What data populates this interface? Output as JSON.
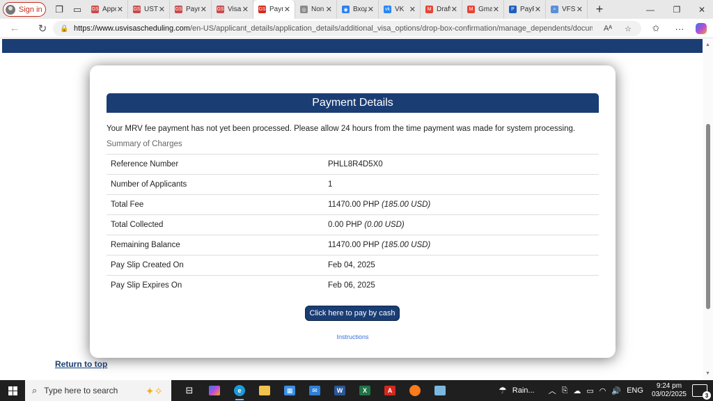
{
  "browser": {
    "signin_label": "Sign in",
    "tabs": [
      {
        "label": "Appointment",
        "color": "#c84b4b",
        "glyph": "GS"
      },
      {
        "label": "UST",
        "color": "#c84b4b",
        "glyph": "GS"
      },
      {
        "label": "Payment",
        "color": "#c84b4b",
        "glyph": "GS"
      },
      {
        "label": "Visa",
        "color": "#c84b4b",
        "glyph": "GS"
      },
      {
        "label": "Payment",
        "color": "#d52b1e",
        "glyph": "GS",
        "active": true
      },
      {
        "label": "Non",
        "color": "#8a8a8a",
        "glyph": "◎"
      },
      {
        "label": "Вход",
        "color": "#2f7ff0",
        "glyph": "◉"
      },
      {
        "label": "VK",
        "color": "#2787f5",
        "glyph": "vk"
      },
      {
        "label": "Drafts",
        "color": "#e84335",
        "glyph": "M"
      },
      {
        "label": "Gmail",
        "color": "#e84335",
        "glyph": "M"
      },
      {
        "label": "PayPal",
        "color": "#1f5fbf",
        "glyph": "P"
      },
      {
        "label": "VFS",
        "color": "#5a8fd8",
        "glyph": "⌕"
      }
    ],
    "url_host": "https://www.usvisascheduling.com",
    "url_path": "/en-US/applicant_details/application_details/additional_visa_options/drop-box-confirmation/manage_dependents/documen..."
  },
  "page": {
    "title": "Payment Details",
    "notice": "Your MRV fee payment has not yet been processed. Please allow 24 hours from the time payment was made for system processing.",
    "summary_label": "Summary of Charges",
    "rows": [
      {
        "key": "Reference Number",
        "value": "PHLL8R4D5X0",
        "extra": ""
      },
      {
        "key": "Number of Applicants",
        "value": "1",
        "extra": ""
      },
      {
        "key": "Total Fee",
        "value": "11470.00 PHP",
        "extra": "(185.00 USD)"
      },
      {
        "key": "Total Collected",
        "value": "0.00 PHP",
        "extra": "(0.00 USD)"
      },
      {
        "key": "Remaining Balance",
        "value": "11470.00 PHP",
        "extra": "(185.00 USD)"
      },
      {
        "key": "Pay Slip Created On",
        "value": "Feb 04, 2025",
        "extra": ""
      },
      {
        "key": "Pay Slip Expires On",
        "value": "Feb 06, 2025",
        "extra": ""
      }
    ],
    "pay_button": "Click here to pay by cash",
    "instructions_link": "Instructions",
    "return_to_top": "Return to top"
  },
  "taskbar": {
    "search_placeholder": "Type here to search",
    "weather": "Rain...",
    "language": "ENG",
    "time": "9:24 pm",
    "date": "03/02/2025",
    "notifications": "3"
  },
  "colors": {
    "brand_navy": "#1a3d74",
    "link_blue": "#3a6fd8"
  }
}
